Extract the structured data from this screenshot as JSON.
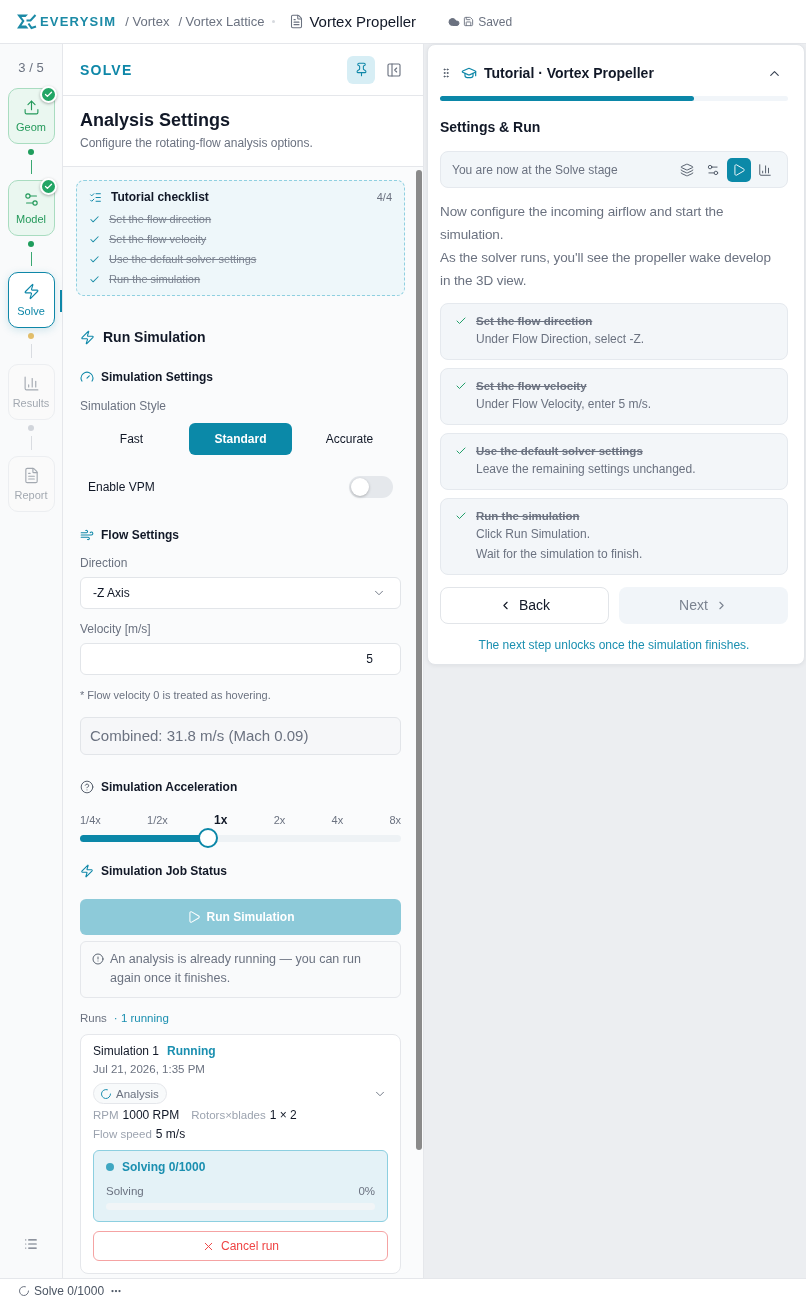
{
  "top_bar": {
    "logo_text": "EVERYSIM",
    "breadcrumbs": [
      "/ Vortex",
      "/ Vortex Lattice"
    ],
    "document_title": "Vortex Propeller",
    "save_status": "Saved"
  },
  "stepper": {
    "counter": "3 / 5",
    "steps": [
      {
        "label": "Geom",
        "kind": "geometry",
        "selected": false,
        "completed": true,
        "disabled": false
      },
      {
        "label": "Model",
        "kind": "model",
        "selected": false,
        "completed": true,
        "disabled": false
      },
      {
        "label": "Solve",
        "kind": "solve",
        "selected": true,
        "completed": false,
        "disabled": false
      },
      {
        "label": "Results",
        "kind": "results",
        "selected": false,
        "completed": false,
        "disabled": true
      },
      {
        "label": "Report",
        "kind": "report",
        "selected": false,
        "completed": false,
        "disabled": true
      }
    ]
  },
  "panel": {
    "title": "SOLVE",
    "pinned": true,
    "heading": "Analysis Settings",
    "subtitle": "Configure the rotating-flow analysis options.",
    "checklist": {
      "title": "Tutorial checklist",
      "count": "4/4",
      "items": [
        {
          "label": "Set the flow direction",
          "checked": true
        },
        {
          "label": "Set the flow velocity",
          "checked": true
        },
        {
          "label": "Use the default solver settings",
          "checked": true
        },
        {
          "label": "Run the simulation",
          "checked": true
        }
      ]
    },
    "run_section": {
      "title": "Run Simulation"
    },
    "simulation_settings": {
      "title": "Simulation Settings",
      "style_label": "Simulation Style",
      "styles": [
        {
          "label": "Fast",
          "selected": false
        },
        {
          "label": "Standard",
          "selected": true
        },
        {
          "label": "Accurate",
          "selected": false
        }
      ],
      "vpm": {
        "label": "Enable VPM",
        "on": false
      }
    },
    "flow_settings": {
      "title": "Flow Settings",
      "direction": {
        "label": "Direction",
        "value": "-Z Axis"
      },
      "velocity": {
        "label": "Velocity [m/s]",
        "value": "5"
      },
      "note": "* Flow velocity 0 is treated as hovering.",
      "combined": "Combined: 31.8 m/s (Mach 0.09)"
    },
    "acceleration": {
      "title": "Simulation Acceleration",
      "ticks": [
        {
          "label": "1/4x",
          "selected": false
        },
        {
          "label": "1/2x",
          "selected": false
        },
        {
          "label": "1x",
          "selected": true
        },
        {
          "label": "2x",
          "selected": false
        },
        {
          "label": "4x",
          "selected": false
        },
        {
          "label": "8x",
          "selected": false
        }
      ],
      "level": 0.4
    },
    "job_status": {
      "title": "Simulation Job Status",
      "run_button": {
        "label": "Run Simulation",
        "disabled": true
      },
      "notice": "An analysis is already running — you can run again once it finishes.",
      "runs_label": "Runs",
      "runs_count": "· 1 running",
      "runs": [
        {
          "name": "Simulation 1",
          "status": "Running",
          "date": "Jul 21, 2026, 1:35 PM",
          "tag": "Analysis",
          "stat_rows": [
            [
              {
                "label": "RPM",
                "value": "1000 RPM"
              },
              {
                "label": "Rotors×blades",
                "value": "1 × 2"
              }
            ],
            [
              {
                "label": "Flow speed",
                "value": "5 m/s"
              }
            ]
          ],
          "progress": {
            "title": "Solving 0/1000",
            "label": "Solving",
            "percent": "0%"
          },
          "cancel": "Cancel run"
        }
      ]
    }
  },
  "tutorial": {
    "title": "Tutorial · Vortex Propeller",
    "expanded": true,
    "level": 0.73,
    "step_title": "Settings & Run",
    "stage_text": "You are now at the Solve stage",
    "stage_icons": [
      {
        "kind": "geometry",
        "selected": false
      },
      {
        "kind": "model",
        "selected": false
      },
      {
        "kind": "solve",
        "selected": true
      },
      {
        "kind": "results",
        "selected": false
      }
    ],
    "paragraphs": [
      "Now configure the incoming airflow and start the simulation.",
      "As the solver runs, you'll see the propeller wake develop in the 3D view."
    ],
    "tasks": [
      {
        "title": "Set the flow direction",
        "done": true,
        "lines": [
          "Under Flow Direction, select -Z."
        ]
      },
      {
        "title": "Set the flow velocity",
        "done": true,
        "lines": [
          "Under Flow Velocity, enter 5 m/s."
        ]
      },
      {
        "title": "Use the default solver settings",
        "done": true,
        "lines": [
          "Leave the remaining settings unchanged."
        ]
      },
      {
        "title": "Run the simulation",
        "done": true,
        "lines": [
          "Click Run Simulation.",
          "Wait for the simulation to finish."
        ]
      }
    ],
    "back": "Back",
    "next": {
      "label": "Next",
      "disabled": true
    },
    "hint": "The next step unlocks once the simulation finishes."
  },
  "status_bar": {
    "text": "Solve 0/1000"
  }
}
